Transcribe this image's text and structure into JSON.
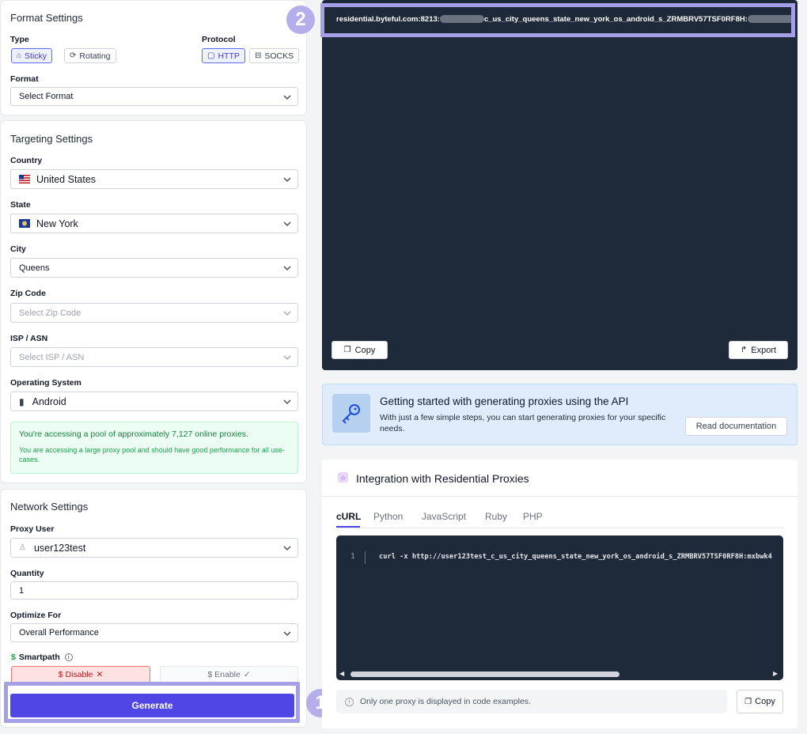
{
  "format": {
    "title": "Format Settings",
    "type_label": "Type",
    "type_sticky": "Sticky",
    "type_rotating": "Rotating",
    "protocol_label": "Protocol",
    "protocol_http": "HTTP",
    "protocol_socks": "SOCKS",
    "format_label": "Format",
    "format_placeholder": "Select Format"
  },
  "targeting": {
    "title": "Targeting Settings",
    "country_label": "Country",
    "country_value": "United States",
    "state_label": "State",
    "state_value": "New York",
    "city_label": "City",
    "city_value": "Queens",
    "zip_label": "Zip Code",
    "zip_placeholder": "Select Zip Code",
    "isp_label": "ISP / ASN",
    "isp_placeholder": "Select ISP / ASN",
    "os_label": "Operating System",
    "os_value": "Android",
    "pool_main": "You're accessing a pool of approximately 7,127 online proxies.",
    "pool_sub": "You are accessing a large proxy pool and should have good performance for all use-cases."
  },
  "network": {
    "title": "Network Settings",
    "proxy_user_label": "Proxy User",
    "proxy_user_value": "user123test",
    "quantity_label": "Quantity",
    "quantity_value": "1",
    "optimize_label": "Optimize For",
    "optimize_value": "Overall Performance",
    "smartpath_label": "Smartpath",
    "disable_label": "Disable",
    "enable_label": "Enable",
    "generate_label": "Generate"
  },
  "output": {
    "proxy_prefix": "residential.byteful.com:8213:",
    "proxy_middle": "c_us_city_queens_state_new_york_os_android_s_ZRMBRV57TSF0RF8H:",
    "copy_label": "Copy",
    "export_label": "Export"
  },
  "api_banner": {
    "title": "Getting started with generating proxies using the API",
    "desc": "With just a few simple steps, you can start generating proxies for your specific needs.",
    "button": "Read documentation"
  },
  "integration": {
    "title": "Integration with Residential Proxies",
    "tabs": [
      "cURL",
      "Python",
      "JavaScript",
      "Ruby",
      "PHP"
    ],
    "line_number": "1",
    "code": "curl -x http://user123test_c_us_city_queens_state_new_york_os_android_s_ZRMBRV57TSF0RF8H:mxbwk4",
    "note": "Only one proxy is displayed in code examples.",
    "copy_label": "Copy"
  },
  "annotations": {
    "badge_one": "1",
    "badge_two": "2"
  },
  "colors": {
    "accent": "#4f46e5",
    "highlight": "#a5a0e6",
    "code_bg": "#1e2a3a",
    "success_bg": "#ecfdf3",
    "danger_bg": "#fee2e2"
  }
}
